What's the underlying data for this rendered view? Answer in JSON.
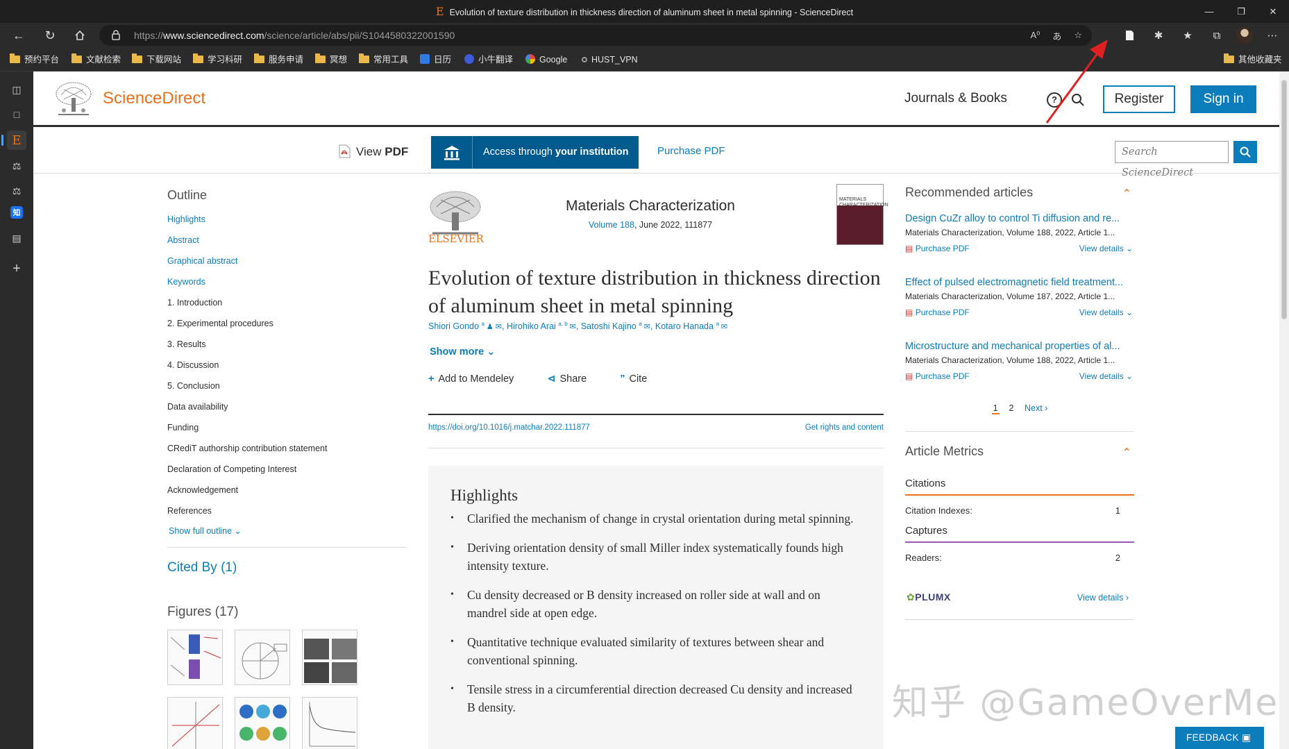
{
  "window": {
    "title": "Evolution of texture distribution in thickness direction of aluminum sheet in metal spinning - ScienceDirect",
    "favicon_letter": "E"
  },
  "address_bar": {
    "url_prefix": "https://",
    "url_host": "www.sciencedirect.com",
    "url_path": "/science/article/abs/pii/S1044580322001590"
  },
  "bookmarks": [
    {
      "label": "预约平台",
      "icon": "folder-icon"
    },
    {
      "label": "文献检索",
      "icon": "folder-icon"
    },
    {
      "label": "下载网站",
      "icon": "folder-icon"
    },
    {
      "label": "学习科研",
      "icon": "folder-icon"
    },
    {
      "label": "服务申请",
      "icon": "folder-icon"
    },
    {
      "label": "冥想",
      "icon": "folder-icon"
    },
    {
      "label": "常用工具",
      "icon": "folder-icon"
    },
    {
      "label": "日历",
      "icon": "calendar-icon"
    },
    {
      "label": "小牛翻译",
      "icon": "translate-icon"
    },
    {
      "label": "Google",
      "icon": "google-icon"
    },
    {
      "label": "HUST_VPN",
      "icon": "vpn-icon"
    }
  ],
  "bookmarks_other": "其他收藏夹",
  "sidebar_icons": [
    "tabs-icon",
    "page-icon",
    "elsevier-e-icon",
    "extension-icon",
    "extension-icon",
    "zhihu-icon",
    "app-icon",
    "add-icon"
  ],
  "sidebar_zhihu": "知",
  "header": {
    "brand": "ScienceDirect",
    "journals_books": "Journals & Books",
    "help": "?",
    "register": "Register",
    "sign_in": "Sign in"
  },
  "toolbar": {
    "view_pdf_pre": "View ",
    "view_pdf_bold": "PDF",
    "access_pre": "Access through ",
    "access_bold": "your institution",
    "purchase_pdf": "Purchase PDF",
    "search_placeholder": "Search ScienceDirect"
  },
  "outline": {
    "heading": "Outline",
    "items": [
      {
        "label": "Highlights",
        "link": true
      },
      {
        "label": "Abstract",
        "link": true
      },
      {
        "label": "Graphical abstract",
        "link": true
      },
      {
        "label": "Keywords",
        "link": true
      },
      {
        "label": "1. Introduction",
        "link": false
      },
      {
        "label": "2. Experimental procedures",
        "link": false
      },
      {
        "label": "3. Results",
        "link": false
      },
      {
        "label": "4. Discussion",
        "link": false
      },
      {
        "label": "5. Conclusion",
        "link": false
      },
      {
        "label": "Data availability",
        "link": false
      },
      {
        "label": "Funding",
        "link": false
      },
      {
        "label": "CRediT authorship contribution statement",
        "link": false
      },
      {
        "label": "Declaration of Competing Interest",
        "link": false
      },
      {
        "label": "Acknowledgement",
        "link": false
      },
      {
        "label": "References",
        "link": false
      }
    ],
    "show_full": "Show full outline",
    "cited_by": "Cited By (1)",
    "figures": "Figures (17)"
  },
  "article": {
    "publisher_word": "ELSEVIER",
    "journal": "Materials Characterization",
    "volume_link": "Volume 188",
    "volume_rest": ", June 2022, 111877",
    "cover_text": "MATERIALS CHARACTERIZATION",
    "title": "Evolution of texture distribution in thickness direction of aluminum sheet in metal spinning",
    "authors": [
      {
        "name": "Shiori Gondo",
        "sup": "a"
      },
      {
        "name": "Hirohiko Arai",
        "sup": "a, b"
      },
      {
        "name": "Satoshi Kajino",
        "sup": "a"
      },
      {
        "name": "Kotaro Hanada",
        "sup": "a"
      }
    ],
    "show_more": "Show more",
    "add_mendeley": "Add to Mendeley",
    "share": "Share",
    "cite": "Cite",
    "doi": "https://doi.org/10.1016/j.matchar.2022.111877",
    "rights": "Get rights and content",
    "highlights_heading": "Highlights",
    "highlights": [
      "Clarified the mechanism of change in crystal orientation during metal spinning.",
      "Deriving orientation density of small Miller index systematically founds high intensity texture.",
      "Cu density decreased or B density increased on roller side at wall and on mandrel side at open edge.",
      "Quantitative technique evaluated similarity of textures between shear and conventional spinning.",
      "Tensile stress in a circumferential direction decreased Cu density and increased B density."
    ]
  },
  "recommended": {
    "heading": "Recommended articles",
    "items": [
      {
        "title": "Design CuZr alloy to control Ti diffusion and re...",
        "meta": "Materials Characterization, Volume 188, 2022, Article 1...",
        "purchase": "Purchase PDF",
        "details": "View details"
      },
      {
        "title": "Effect of pulsed electromagnetic field treatment...",
        "meta": "Materials Characterization, Volume 187, 2022, Article 1...",
        "purchase": "Purchase PDF",
        "details": "View details"
      },
      {
        "title": "Microstructure and mechanical properties of al...",
        "meta": "Materials Characterization, Volume 188, 2022, Article 1...",
        "purchase": "Purchase PDF",
        "details": "View details"
      }
    ],
    "page1": "1",
    "page2": "2",
    "next": "Next"
  },
  "metrics": {
    "heading": "Article Metrics",
    "citations": "Citations",
    "citation_indexes_label": "Citation Indexes:",
    "citation_indexes_value": "1",
    "captures": "Captures",
    "readers_label": "Readers:",
    "readers_value": "2",
    "plumx": "PLUMX",
    "view_details": "View details"
  },
  "watermark": "知乎 @GameOverMe",
  "feedback": "FEEDBACK",
  "colors": {
    "sd_orange": "#e9711c",
    "sd_blue": "#0c7dbb",
    "institution_blue": "#005a8e",
    "citations_bar": "#e9711c",
    "captures_bar": "#9b59b6",
    "annotation_red": "#e02020"
  }
}
